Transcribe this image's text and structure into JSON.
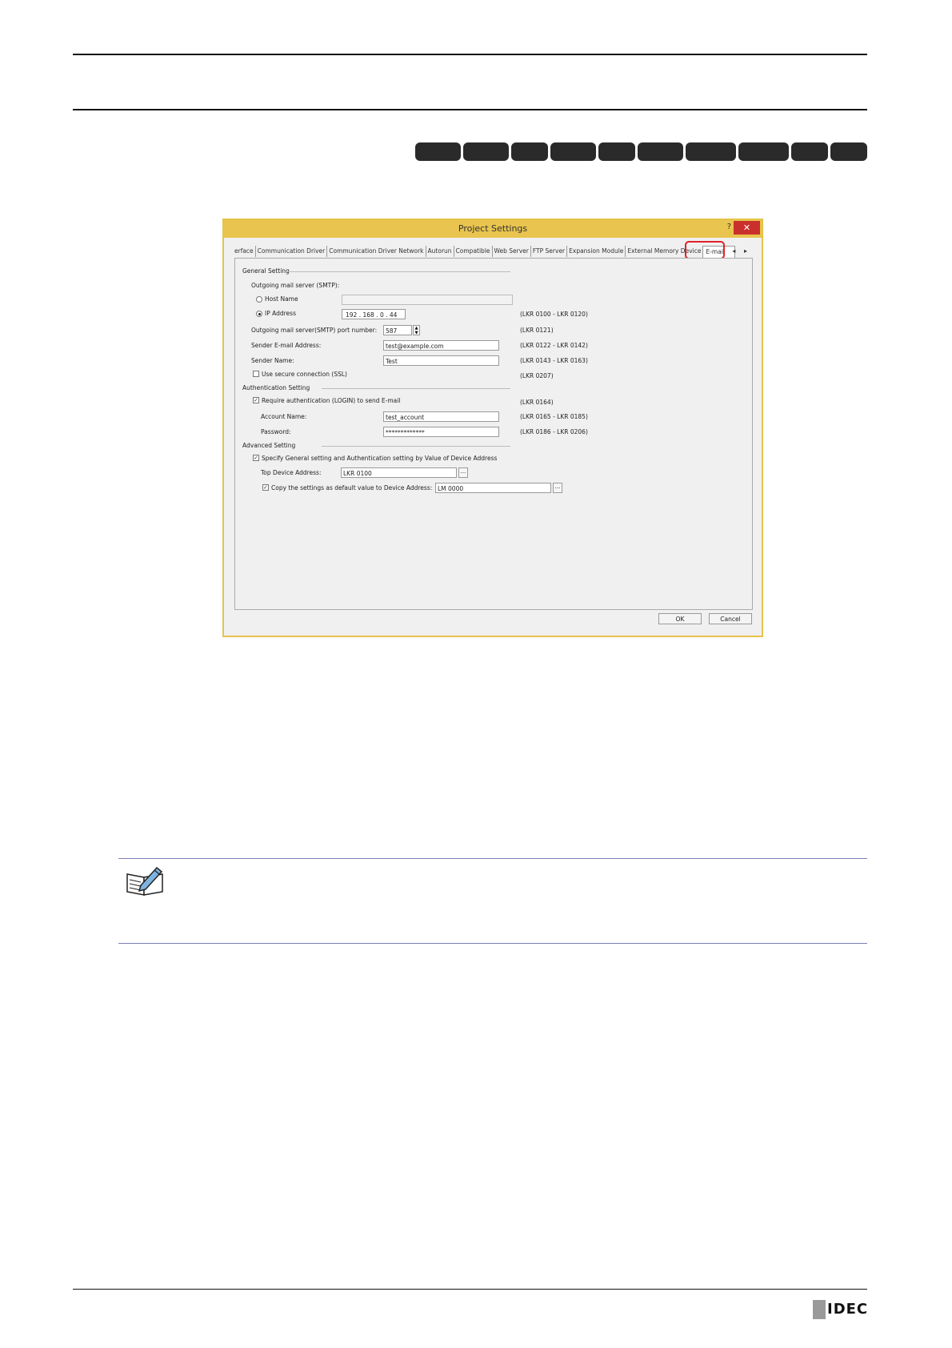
{
  "dialog": {
    "title": "Project Settings",
    "help": "?",
    "close": "✕",
    "tabs": [
      "erface",
      "Communication Driver",
      "Communication Driver Network",
      "Autorun",
      "Compatible",
      "Web Server",
      "FTP Server",
      "Expansion Module",
      "External Memory Device",
      "E-mail"
    ],
    "active_tab": "E-mail",
    "tab_arrows": "◂ ▸",
    "general": {
      "section": "General Setting",
      "outgoing_label": "Outgoing mail server (SMTP):",
      "host_name_label": "Host Name",
      "host_name_value": "",
      "ip_label": "IP Address",
      "ip": [
        "192",
        "168",
        "0",
        "44"
      ],
      "ip_range": "(LKR 0100 - LKR 0120)",
      "port_label": "Outgoing mail server(SMTP) port number:",
      "port_value": "587",
      "port_range": "(LKR 0121)",
      "sender_email_label": "Sender E-mail Address:",
      "sender_email_value": "test@example.com",
      "sender_email_range": "(LKR 0122 - LKR 0142)",
      "sender_name_label": "Sender Name:",
      "sender_name_value": "Test",
      "sender_name_range": "(LKR 0143 - LKR 0163)",
      "ssl_label": "Use secure connection (SSL)",
      "ssl_range": "(LKR 0207)"
    },
    "auth": {
      "section": "Authentication Setting",
      "require_label": "Require authentication (LOGIN) to send E-mail",
      "require_range": "(LKR 0164)",
      "account_label": "Account Name:",
      "account_value": "test_account",
      "account_range": "(LKR 0165 - LKR 0185)",
      "password_label": "Password:",
      "password_value": "*************",
      "password_range": "(LKR 0186 - LKR 0206)"
    },
    "advanced": {
      "section": "Advanced Setting",
      "specify_label": "Specify General setting and Authentication setting by Value of Device Address",
      "top_device_label": "Top Device Address:",
      "top_device_value": "LKR 0100",
      "copy_label": "Copy the settings as default value to Device Address:",
      "copy_value": "LM 0000",
      "browse": "..."
    },
    "ok": "OK",
    "cancel": "Cancel"
  },
  "footer": {
    "logo": "IDEC"
  }
}
